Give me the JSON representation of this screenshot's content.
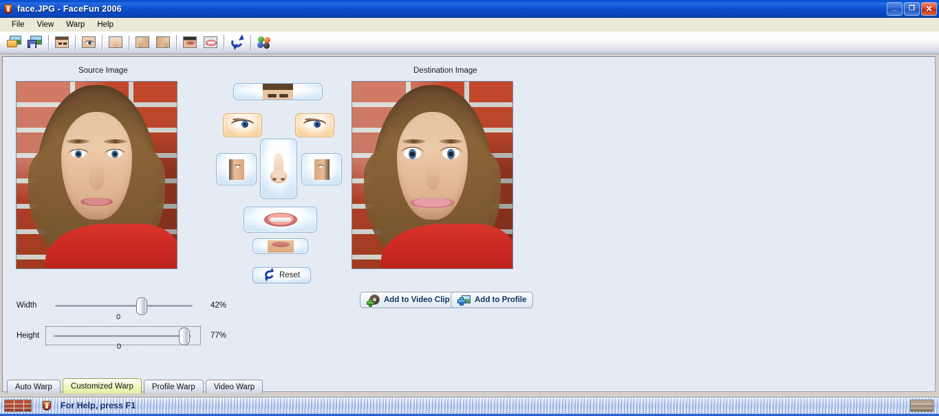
{
  "window": {
    "title": "face.JPG - FaceFun 2006",
    "app_icon": "facefun-shield-icon",
    "controls": {
      "minimize": "minimize-button",
      "restore": "restore-button",
      "close": "close-button",
      "minimize_glyph": "_",
      "restore_glyph": "❐",
      "close_glyph": "✕"
    }
  },
  "menu": {
    "items": [
      {
        "label": "File"
      },
      {
        "label": "View"
      },
      {
        "label": "Warp"
      },
      {
        "label": "Help"
      }
    ]
  },
  "toolbar": {
    "buttons": [
      {
        "name": "open-image-icon",
        "tip": "Open"
      },
      {
        "name": "save-image-icon",
        "tip": "Save"
      },
      {
        "name": "face-icon",
        "tip": "Face"
      },
      {
        "name": "eye-icon",
        "tip": "Eye"
      },
      {
        "name": "nose-icon",
        "tip": "Nose"
      },
      {
        "name": "cheek-left-icon",
        "tip": "Left Cheek"
      },
      {
        "name": "cheek-right-icon",
        "tip": "Right Cheek"
      },
      {
        "name": "chin-icon",
        "tip": "Chin"
      },
      {
        "name": "lips-icon",
        "tip": "Lips"
      },
      {
        "name": "reset-icon",
        "tip": "Reset"
      },
      {
        "name": "color-balance-icon",
        "tip": "Colors"
      }
    ]
  },
  "panels": {
    "source_label": "Source Image",
    "destination_label": "Destination Image"
  },
  "feature_buttons": {
    "forehead": {
      "name": "forehead-button",
      "selected": false
    },
    "eye_left": {
      "name": "eye-left-button",
      "selected": true
    },
    "eye_right": {
      "name": "eye-right-button",
      "selected": true
    },
    "cheek_left": {
      "name": "cheek-left-button",
      "selected": false
    },
    "cheek_right": {
      "name": "cheek-right-button",
      "selected": false
    },
    "nose": {
      "name": "nose-button",
      "selected": false
    },
    "mouth": {
      "name": "mouth-button",
      "selected": false
    },
    "chin": {
      "name": "chin-button",
      "selected": false
    },
    "reset_label": "Reset"
  },
  "actions": {
    "add_to_video_clip": "Add to Video Clip",
    "add_to_profile": "Add to Profile"
  },
  "sliders": {
    "width": {
      "label": "Width",
      "percent": "42%",
      "tick": "0"
    },
    "height": {
      "label": "Height",
      "percent": "77%",
      "tick": "0"
    }
  },
  "tabs": [
    {
      "label": "Auto Warp",
      "active": false
    },
    {
      "label": "Customized Warp",
      "active": true
    },
    {
      "label": "Profile Warp",
      "active": false
    },
    {
      "label": "Video Warp",
      "active": false
    }
  ],
  "statusbar": {
    "text": "For Help, press F1"
  },
  "colors": {
    "title_bar": "#0c4cc8",
    "menu_bar": "#ece9d8",
    "client_background": "#e5ebf3",
    "selected_feature": "#fbd6a6",
    "feature_button": "#cfe4f6",
    "active_tab": "#e4f0a0",
    "status_text": "#15306e"
  }
}
